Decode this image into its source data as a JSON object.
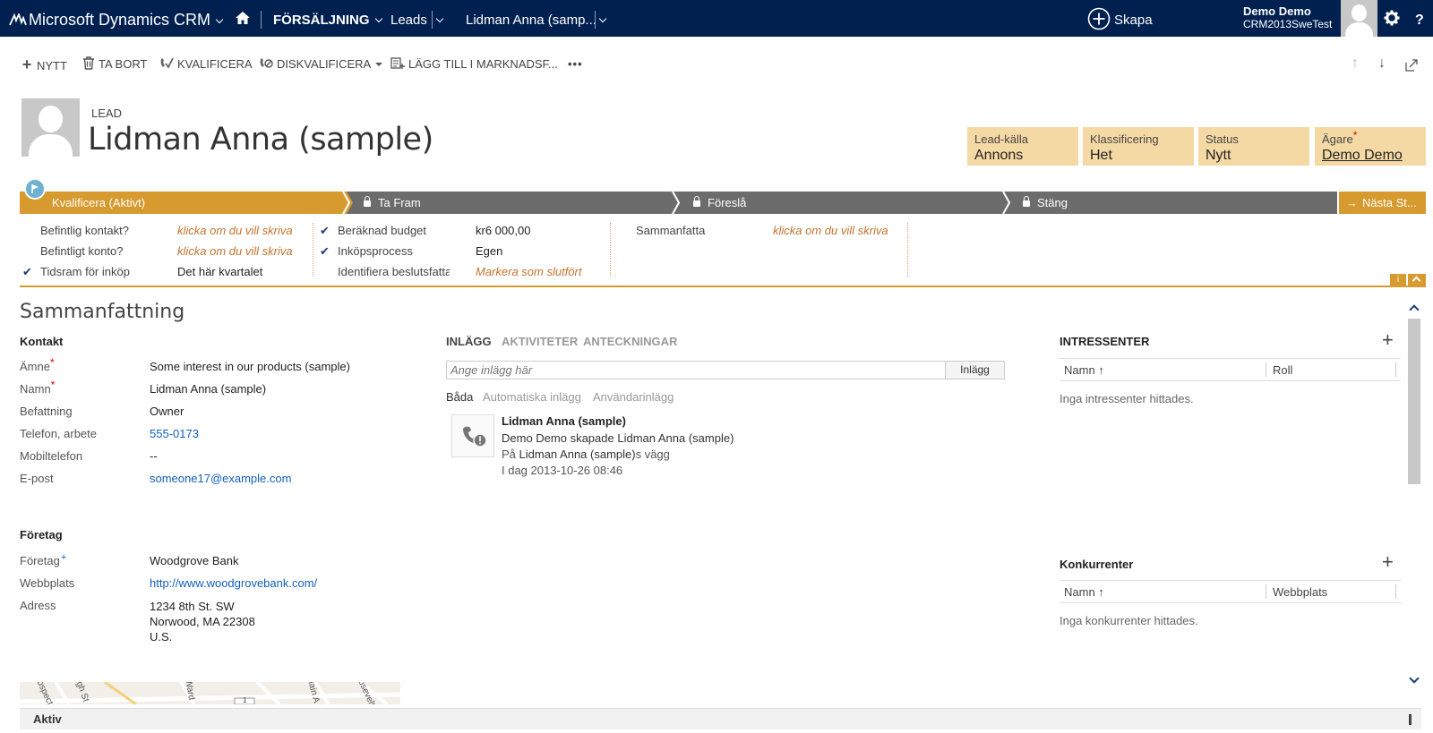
{
  "topnav": {
    "app_name": "Microsoft Dynamics CRM",
    "area": "FÖRSÄLJNING",
    "entity": "Leads",
    "record": "Lidman Anna (samp...",
    "create_label": "Skapa",
    "user_name": "Demo Demo",
    "org_name": "CRM2013SweTest",
    "help_label": "?"
  },
  "commands": [
    {
      "icon": "plus-icon",
      "label": "NYTT"
    },
    {
      "icon": "trash-icon",
      "label": "TA BORT"
    },
    {
      "icon": "qualify-icon",
      "label": "KVALIFICERA"
    },
    {
      "icon": "disqualify-icon",
      "label": "DISKVALIFICERA"
    },
    {
      "icon": "add-to-marketing-list-icon",
      "label": "LÄGG TILL I MARKNADSF..."
    }
  ],
  "more_label": "•••",
  "header": {
    "entity_label": "LEAD",
    "title": "Lidman Anna (sample)",
    "fields": [
      {
        "label": "Lead-källa",
        "value": "Annons"
      },
      {
        "label": "Klassificering",
        "value": "Het"
      },
      {
        "label": "Status",
        "value": "Nytt"
      },
      {
        "label": "Ägare",
        "value": "Demo Demo",
        "required": "*"
      }
    ]
  },
  "process": {
    "stages": [
      {
        "label": "Kvalificera (Aktivt)",
        "active": true
      },
      {
        "label": "Ta Fram",
        "locked": true
      },
      {
        "label": "Föreslå",
        "locked": true
      },
      {
        "label": "Stäng",
        "locked": true
      }
    ],
    "next_label": "Nästa St...",
    "info_label": "i",
    "col1": [
      {
        "label": "Befintlig kontakt?",
        "value": "klicka om du vill skriva",
        "empty": true
      },
      {
        "label": "Befintligt konto?",
        "value": "klicka om du vill skriva",
        "empty": true
      },
      {
        "label": "Tidsram för inköp",
        "value": "Det här kvartalet",
        "checked": true
      }
    ],
    "col2": [
      {
        "label": "Beräknad budget",
        "value": "kr6 000,00",
        "checked": true
      },
      {
        "label": "Inköpsprocess",
        "value": "Egen",
        "checked": true
      },
      {
        "label": "Identifiera beslutsfatta",
        "value": "Markera som slutfört",
        "empty": true
      }
    ],
    "col3": [
      {
        "label": "Sammanfatta",
        "value": "klicka om du vill skriva",
        "empty": true
      }
    ]
  },
  "summary": {
    "title": "Sammanfattning",
    "contact_group": "Kontakt",
    "contact_fields": [
      {
        "label": "Ämne",
        "value": "Some interest in our products (sample)",
        "req": "*"
      },
      {
        "label": "Namn",
        "value": "Lidman Anna (sample)",
        "req": "*"
      },
      {
        "label": "Befattning",
        "value": "Owner"
      },
      {
        "label": "Telefon, arbete",
        "value": "555-0173"
      },
      {
        "label": "Mobiltelefon",
        "value": "--"
      },
      {
        "label": "E-post",
        "value": "someone17@example.com"
      }
    ],
    "company_group": "Företag",
    "company_fields": [
      {
        "label": "Företag",
        "value": "Woodgrove Bank",
        "rec": "+"
      },
      {
        "label": "Webbplats",
        "value": "http://www.woodgrovebank.com/"
      },
      {
        "label": "Adress",
        "value": "1234 8th St. SW"
      }
    ],
    "address_lines": [
      "Norwood, MA 22308",
      "U.S."
    ]
  },
  "social": {
    "tabs": [
      "INLÄGG",
      "AKTIVITETER",
      "ANTECKNINGAR"
    ],
    "post_placeholder": "Ange inlägg här",
    "post_button": "Inlägg",
    "filters": [
      "Båda",
      "Automatiska inlägg",
      "Användarinlägg"
    ],
    "post": {
      "title": "Lidman Anna (sample)",
      "line1": "Demo Demo skapade Lidman Anna (sample)",
      "line2_prefix": "På ",
      "line2_link": "Lidman Anna (sample)",
      "line2_suffix": "s vägg",
      "timestamp": "I dag 2013-10-26 08:46"
    }
  },
  "stakeholders": {
    "title": "INTRESSENTER",
    "columns": [
      "Namn ↑",
      "Roll"
    ],
    "empty": "Inga intressenter hittades."
  },
  "competitors": {
    "title": "Konkurrenter",
    "columns": [
      "Namn ↑",
      "Webbplats"
    ],
    "empty": "Inga konkurrenter hittades."
  },
  "map_labels": [
    "Prospect",
    "High St",
    "Ward",
    "Main A",
    "Roosevelt",
    "1"
  ],
  "status_bar": {
    "label": "Aktiv"
  },
  "colors": {
    "nav": "#002050",
    "process_active": "#d69a2f",
    "process_inactive": "#6c6c6c",
    "header_field_bg": "#f5d9a4",
    "link": "#1160b7"
  }
}
